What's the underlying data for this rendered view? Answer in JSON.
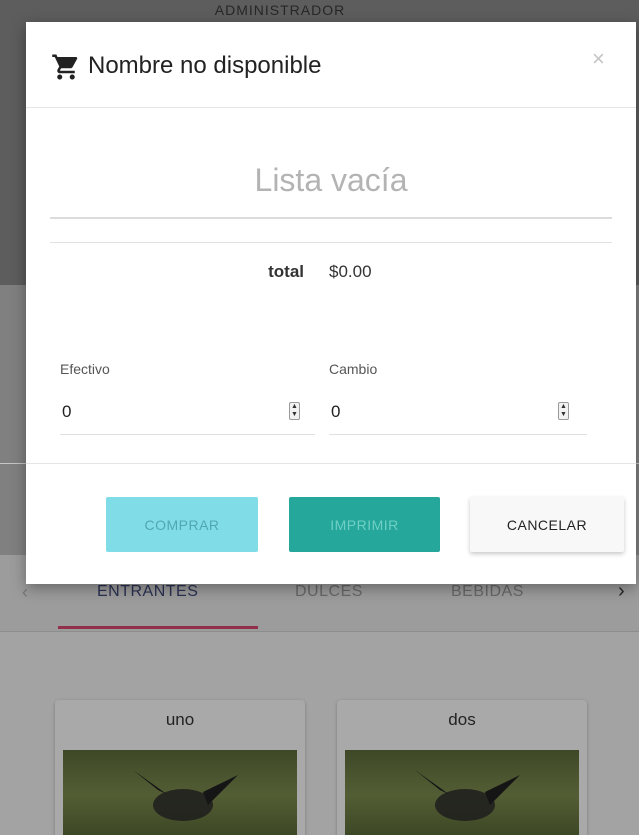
{
  "background": {
    "header_title": "ADMINISTRADOR",
    "tabs": [
      {
        "label": "ENTRANTES",
        "active": true
      },
      {
        "label": "DULCES",
        "active": false
      },
      {
        "label": "BEBIDAS",
        "active": false
      }
    ],
    "cards": [
      {
        "title": "uno"
      },
      {
        "title": "dos"
      }
    ],
    "arrow_left": "‹",
    "arrow_right": "›"
  },
  "modal": {
    "cart_icon": "shopping-cart-icon",
    "title": "Nombre no disponible",
    "close_label": "×",
    "empty_text": "Lista vacía",
    "total_label": "total",
    "total_value": "$0.00",
    "efectivo": {
      "label": "Efectivo",
      "value": "0"
    },
    "cambio": {
      "label": "Cambio",
      "value": "0"
    },
    "buttons": {
      "comprar": "COMPRAR",
      "imprimir": "IMPRIMIR",
      "cancelar": "CANCELAR"
    }
  },
  "colors": {
    "comprar_bg": "#80dde8",
    "imprimir_bg": "#26a79b",
    "tab_indicator": "#d8486f"
  }
}
